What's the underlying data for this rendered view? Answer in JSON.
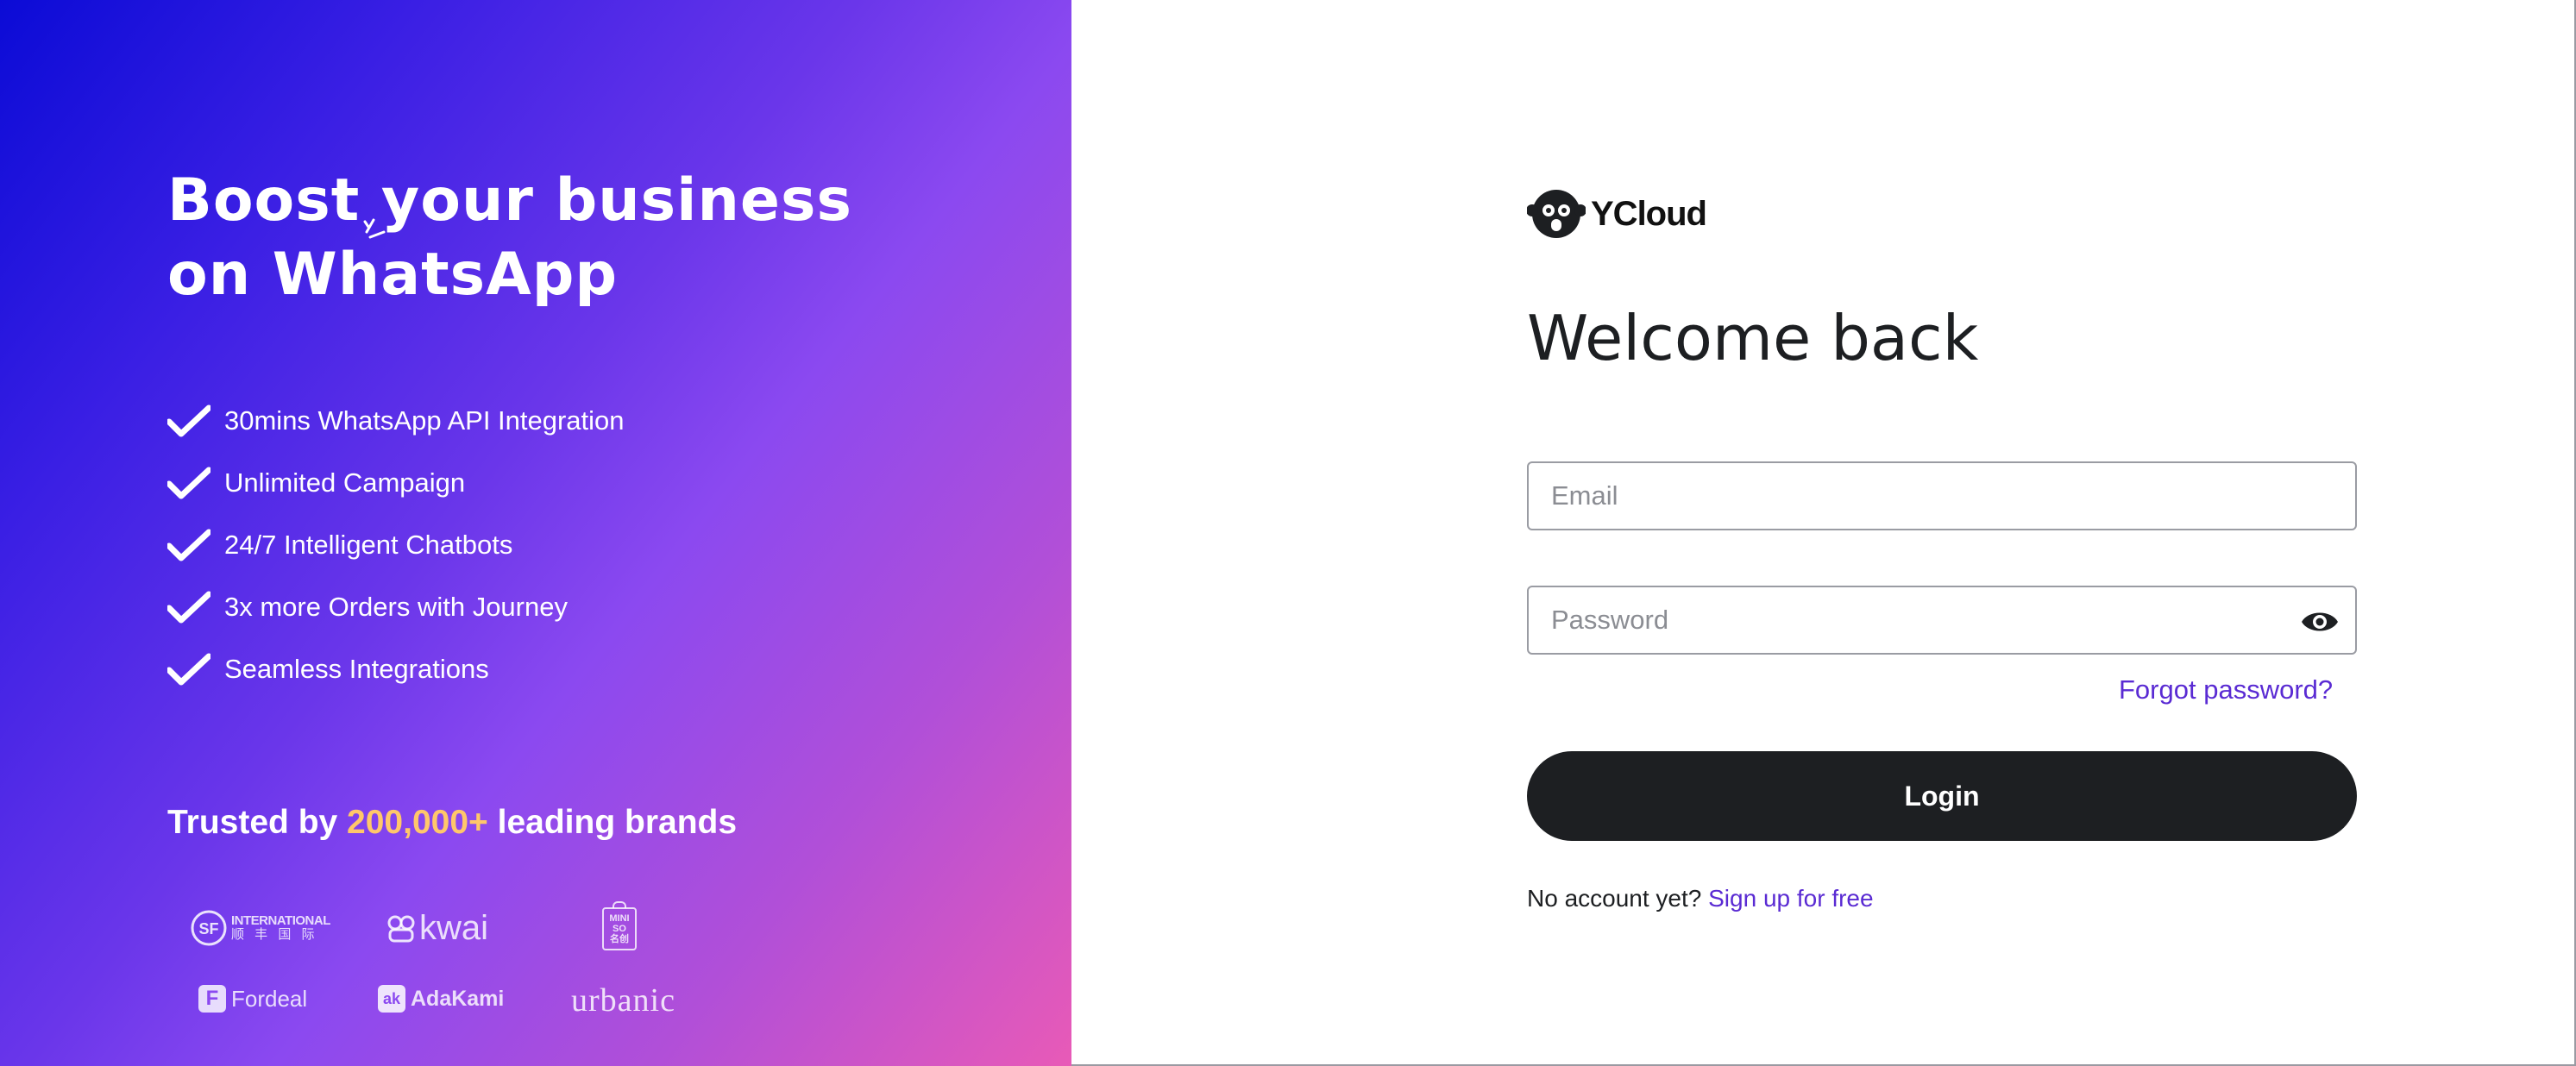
{
  "promo": {
    "title_line1_part1": "Boost",
    "title_line1_part2": " your business",
    "title_line2": "on WhatsApp",
    "features": [
      {
        "label": "30mins WhatsApp API Integration",
        "icon": "check-icon"
      },
      {
        "label": "Unlimited Campaign",
        "icon": "check-icon"
      },
      {
        "label": "24/7 Intelligent Chatbots",
        "icon": "check-icon"
      },
      {
        "label": "3x more Orders with Journey",
        "icon": "check-icon"
      },
      {
        "label": "Seamless Integrations",
        "icon": "check-icon"
      }
    ],
    "trusted_prefix": "Trusted by ",
    "trusted_count": "200,000+",
    "trusted_suffix": " leading brands",
    "brands": {
      "sf_line1": "INTERNATIONAL",
      "sf_line2": "顺 丰 国 际",
      "kwai": "kwai",
      "mini_line1": "MINI",
      "mini_line2": "SO",
      "mini_line3": "名创",
      "fordeal": "Fordeal",
      "adakami": "AdaKami",
      "urbanic": "urbanic"
    },
    "colors": {
      "highlight": "#ffc76a",
      "gradient_start": "#0b0bd6",
      "gradient_end": "#e85ab7"
    }
  },
  "login": {
    "brand_name": "YCloud",
    "heading": "Welcome back",
    "email_placeholder": "Email",
    "email_value": "",
    "password_placeholder": "Password",
    "password_value": "",
    "password_toggle_icon": "eye-icon",
    "forgot_label": "Forgot password?",
    "login_label": "Login",
    "signup_prompt": "No account yet? ",
    "signup_link": "Sign up for free",
    "colors": {
      "link": "#5a2bd3",
      "button": "#1d1f22"
    }
  }
}
